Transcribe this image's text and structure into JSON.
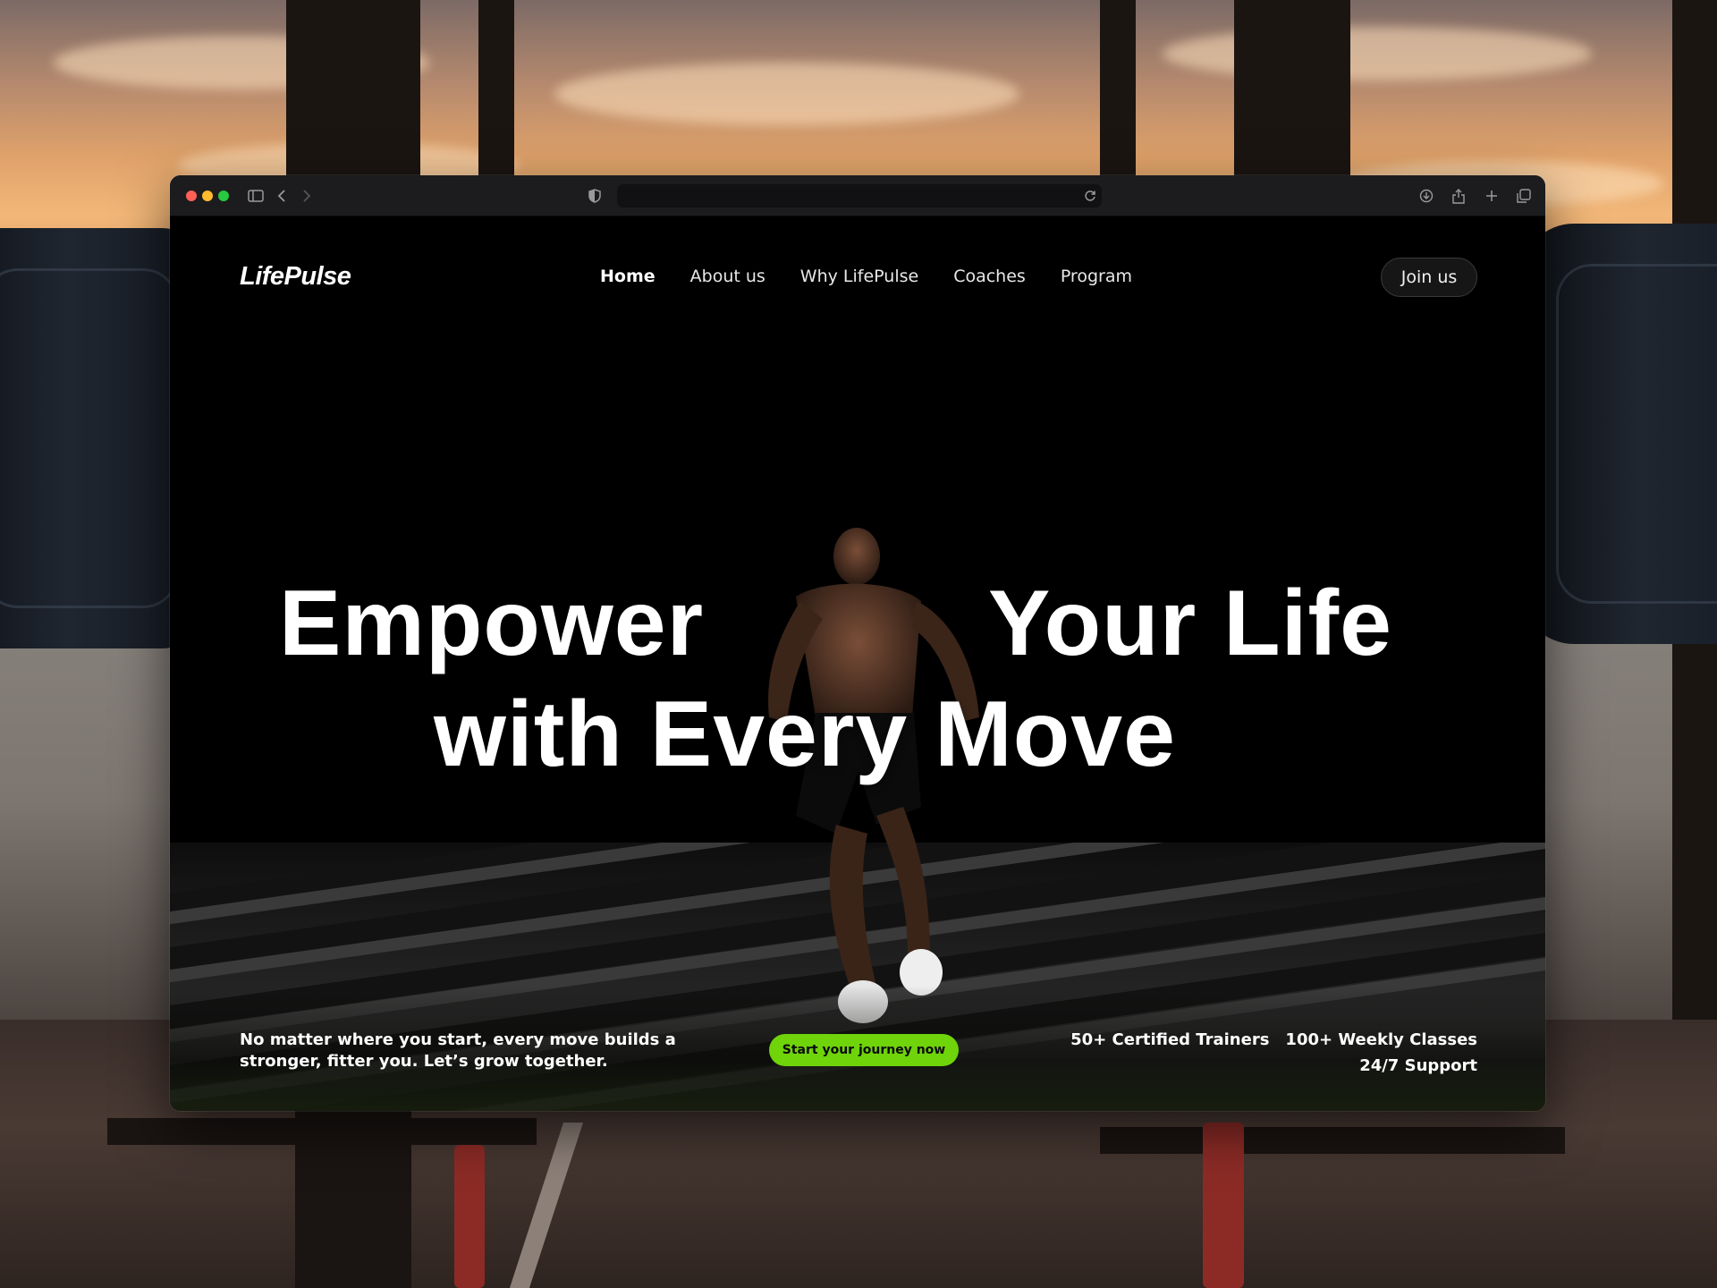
{
  "brand": {
    "name": "LifePulse",
    "accent_color": "#6fd40a"
  },
  "browser": {
    "traffic_lights": [
      "#ff5f57",
      "#febc2e",
      "#28c840"
    ],
    "icons": [
      "sidebar-icon",
      "back-icon",
      "forward-icon",
      "shield-icon",
      "reload-icon",
      "download-icon",
      "share-icon",
      "new-tab-icon",
      "tabs-overview-icon"
    ]
  },
  "nav": {
    "items": [
      {
        "label": "Home",
        "active": true
      },
      {
        "label": "About us",
        "active": false
      },
      {
        "label": "Why LifePulse",
        "active": false
      },
      {
        "label": "Coaches",
        "active": false
      },
      {
        "label": "Program",
        "active": false
      }
    ],
    "join_label": "Join us"
  },
  "hero": {
    "line1_a": "Empower",
    "line1_b": "Your Life",
    "line2": "with Every Move"
  },
  "footer": {
    "tagline": "No matter where you start, every move builds a stronger, fitter you. Let’s grow together.",
    "cta_label": "Start your journey now",
    "stats": [
      "50+ Certified Trainers",
      "100+ Weekly Classes",
      "24/7 Support"
    ]
  }
}
